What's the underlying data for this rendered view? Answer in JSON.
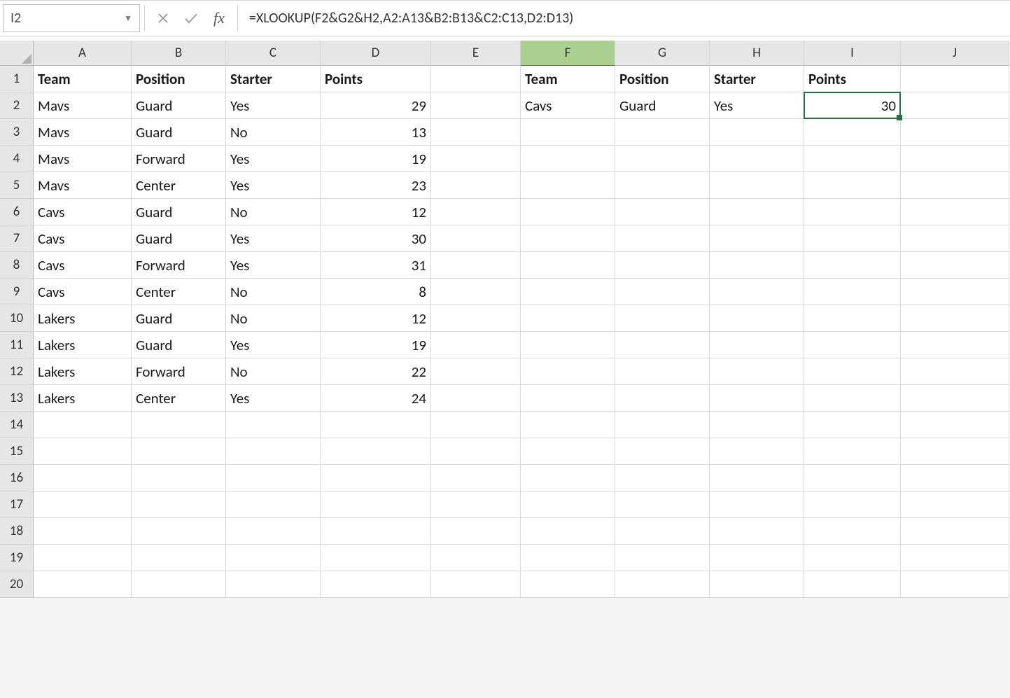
{
  "name_box": {
    "value": "I2"
  },
  "formula_bar": {
    "fx_label": "fx",
    "value": "=XLOOKUP(F2&G2&H2,A2:A13&B2:B13&C2:C13,D2:D13)"
  },
  "columns": [
    "A",
    "B",
    "C",
    "D",
    "E",
    "F",
    "G",
    "H",
    "I",
    "J"
  ],
  "highlighted_column": "F",
  "selected_cell": "I2",
  "rows_shown": 20,
  "headers_row": {
    "A": "Team",
    "B": "Position",
    "C": "Starter",
    "D": "Points",
    "F": "Team",
    "G": "Position",
    "H": "Starter",
    "I": "Points"
  },
  "data": [
    {
      "A": "Mavs",
      "B": "Guard",
      "C": "Yes",
      "D": "29",
      "F": "Cavs",
      "G": "Guard",
      "H": "Yes",
      "I": "30"
    },
    {
      "A": "Mavs",
      "B": "Guard",
      "C": "No",
      "D": "13"
    },
    {
      "A": "Mavs",
      "B": "Forward",
      "C": "Yes",
      "D": "19"
    },
    {
      "A": "Mavs",
      "B": "Center",
      "C": "Yes",
      "D": "23"
    },
    {
      "A": "Cavs",
      "B": "Guard",
      "C": "No",
      "D": "12"
    },
    {
      "A": "Cavs",
      "B": "Guard",
      "C": "Yes",
      "D": "30"
    },
    {
      "A": "Cavs",
      "B": "Forward",
      "C": "Yes",
      "D": "31"
    },
    {
      "A": "Cavs",
      "B": "Center",
      "C": "No",
      "D": "8"
    },
    {
      "A": "Lakers",
      "B": "Guard",
      "C": "No",
      "D": "12"
    },
    {
      "A": "Lakers",
      "B": "Guard",
      "C": "Yes",
      "D": "19"
    },
    {
      "A": "Lakers",
      "B": "Forward",
      "C": "No",
      "D": "22"
    },
    {
      "A": "Lakers",
      "B": "Center",
      "C": "Yes",
      "D": "24"
    }
  ],
  "chart_data": {
    "type": "table",
    "title": "XLOOKUP multi-criteria example",
    "main_table": {
      "columns": [
        "Team",
        "Position",
        "Starter",
        "Points"
      ],
      "rows": [
        [
          "Mavs",
          "Guard",
          "Yes",
          29
        ],
        [
          "Mavs",
          "Guard",
          "No",
          13
        ],
        [
          "Mavs",
          "Forward",
          "Yes",
          19
        ],
        [
          "Mavs",
          "Center",
          "Yes",
          23
        ],
        [
          "Cavs",
          "Guard",
          "No",
          12
        ],
        [
          "Cavs",
          "Guard",
          "Yes",
          30
        ],
        [
          "Cavs",
          "Forward",
          "Yes",
          31
        ],
        [
          "Cavs",
          "Center",
          "No",
          8
        ],
        [
          "Lakers",
          "Guard",
          "No",
          12
        ],
        [
          "Lakers",
          "Guard",
          "Yes",
          19
        ],
        [
          "Lakers",
          "Forward",
          "No",
          22
        ],
        [
          "Lakers",
          "Center",
          "Yes",
          24
        ]
      ]
    },
    "lookup_table": {
      "columns": [
        "Team",
        "Position",
        "Starter",
        "Points"
      ],
      "rows": [
        [
          "Cavs",
          "Guard",
          "Yes",
          30
        ]
      ]
    }
  }
}
